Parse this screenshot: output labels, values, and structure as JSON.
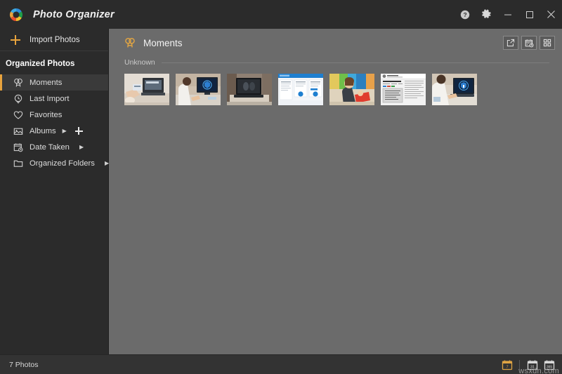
{
  "window": {
    "app_title": "Photo Organizer",
    "logo_icon": "photo-organizer-logo-icon",
    "controls": {
      "help_label": "?",
      "help_icon": "help-circle-icon",
      "settings_icon": "gear-icon",
      "minimize_icon": "minimize-icon",
      "maximize_icon": "maximize-icon",
      "close_icon": "close-icon"
    }
  },
  "sidebar": {
    "import": {
      "label": "Import Photos",
      "icon": "plus-icon"
    },
    "section_title": "Organized Photos",
    "items": [
      {
        "label": "Moments",
        "icon": "moments-icon",
        "active": true,
        "chevron": false,
        "add": false
      },
      {
        "label": "Last Import",
        "icon": "clock-pin-icon",
        "active": false,
        "chevron": false,
        "add": false
      },
      {
        "label": "Favorites",
        "icon": "heart-icon",
        "active": false,
        "chevron": false,
        "add": false
      },
      {
        "label": "Albums",
        "icon": "picture-icon",
        "active": false,
        "chevron": true,
        "add": true
      },
      {
        "label": "Date Taken",
        "icon": "calendar-clock-icon",
        "active": false,
        "chevron": true,
        "add": false
      },
      {
        "label": "Organized Folders",
        "icon": "folder-icon",
        "active": false,
        "chevron": true,
        "add": false
      }
    ],
    "chevron_glyph": "▶",
    "add_icon": "plus-icon"
  },
  "main": {
    "title": "Moments",
    "title_icon": "moments-icon",
    "tools": [
      {
        "name": "open-external-button",
        "icon": "external-link-icon"
      },
      {
        "name": "date-filter-button",
        "icon": "calendar-clock-icon"
      },
      {
        "name": "grid-view-button",
        "icon": "grid-view-icon"
      }
    ],
    "group_label": "Unknown",
    "thumbnails": [
      {
        "name": "photo-thumbnail-1",
        "description": "hands holding card near laptop on desk"
      },
      {
        "name": "photo-thumbnail-2",
        "description": "person at desktop monitor with blue security graphic"
      },
      {
        "name": "photo-thumbnail-3",
        "description": "open laptop on table showing dark screen"
      },
      {
        "name": "photo-thumbnail-4",
        "description": "blue web page screenshot with two round badges"
      },
      {
        "name": "photo-thumbnail-5",
        "description": "woman with child in colorful room"
      },
      {
        "name": "photo-thumbnail-6",
        "description": "document screenshot with handwritten note image"
      },
      {
        "name": "photo-thumbnail-7",
        "description": "person typing on laptop with blue shield graphic"
      }
    ]
  },
  "statusbar": {
    "count_text": "7 Photos",
    "view_buttons": [
      {
        "name": "year-view-button",
        "icon": "calendar-year-icon",
        "selected": true,
        "glyph": "7"
      },
      {
        "name": "month-view-button",
        "icon": "calendar-month-icon",
        "selected": false,
        "glyph": "31"
      },
      {
        "name": "day-view-button",
        "icon": "calendar-day-icon",
        "selected": false,
        "glyph": "365"
      }
    ]
  },
  "watermark": {
    "text": "wsxdn.com"
  }
}
